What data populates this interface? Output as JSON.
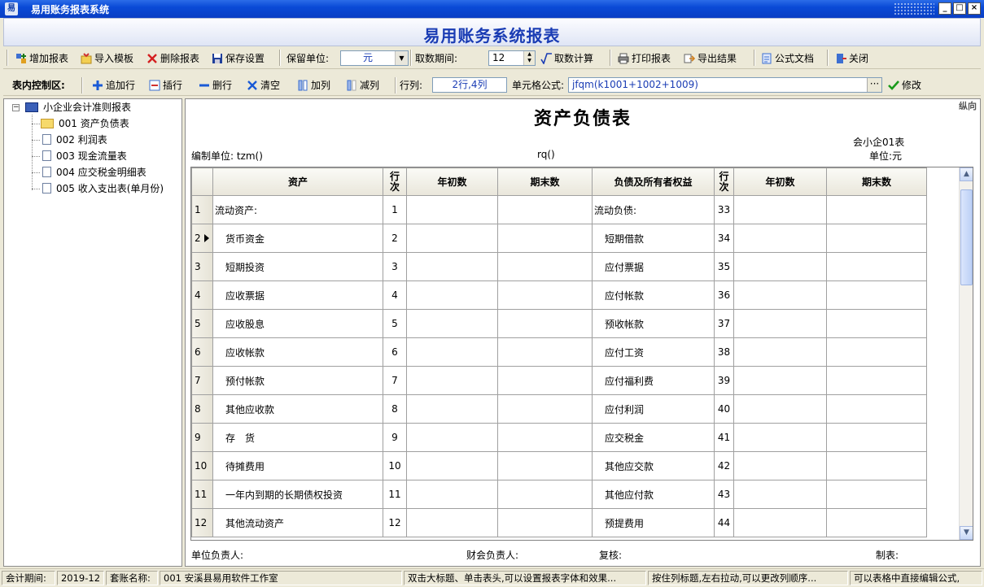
{
  "window": {
    "title": "易用账务报表系统",
    "icon_char": "易",
    "minimize": "_",
    "maximize": "□",
    "close": "×"
  },
  "banner": {
    "title": "易用账务系统报表"
  },
  "toolbar": {
    "add_report": "增加报表",
    "import_template": "导入模板",
    "delete_report": "删除报表",
    "save_settings": "保存设置",
    "unit_label": "保留单位:",
    "unit_value": "元",
    "period_label": "取数期间:",
    "period_value": "12",
    "calc": "取数计算",
    "print": "打印报表",
    "export": "导出结果",
    "formula_doc": "公式文档",
    "close": "关闭"
  },
  "control": {
    "label": "表内控制区:",
    "append_row": "追加行",
    "insert_row": "插行",
    "delete_row": "删行",
    "clear": "清空",
    "add_col": "加列",
    "remove_col": "减列",
    "rowcol_label": "行列:",
    "rowcol_value": "2行,4列",
    "formula_label": "单元格公式:",
    "formula_value": "jfqm(k1001+1002+1009)",
    "ellipsis": "···",
    "modify": "修改"
  },
  "tree": {
    "root": "小企业会计准则报表",
    "items": [
      {
        "code": "001",
        "name": "资产负债表"
      },
      {
        "code": "002",
        "name": "利润表"
      },
      {
        "code": "003",
        "name": "现金流量表"
      },
      {
        "code": "004",
        "name": "应交税金明细表"
      },
      {
        "code": "005",
        "name": "收入支出表(单月份)"
      }
    ]
  },
  "report": {
    "orientation": "纵向",
    "title": "资产负债表",
    "form_code": "会小企01表",
    "compiler": "编制单位: tzm()",
    "date": "rq()",
    "unit": "单位:元",
    "headers": {
      "assets": "资产",
      "line_no": "行次",
      "begin": "年初数",
      "end": "期末数",
      "liabilities": "负债及所有者权益",
      "line_no2": "行次",
      "begin2": "年初数",
      "end2": "期末数"
    },
    "rows": [
      {
        "n": "1",
        "asset": "流动资产:",
        "l1": "1",
        "liab": "流动负债:",
        "l2": "33"
      },
      {
        "n": "2",
        "asset": "货币资金",
        "l1": "2",
        "liab": "短期借款",
        "l2": "34"
      },
      {
        "n": "3",
        "asset": "短期投资",
        "l1": "3",
        "liab": "应付票据",
        "l2": "35"
      },
      {
        "n": "4",
        "asset": "应收票据",
        "l1": "4",
        "liab": "应付帐款",
        "l2": "36"
      },
      {
        "n": "5",
        "asset": "应收股息",
        "l1": "5",
        "liab": "预收帐款",
        "l2": "37"
      },
      {
        "n": "6",
        "asset": "应收帐款",
        "l1": "6",
        "liab": "应付工资",
        "l2": "38"
      },
      {
        "n": "7",
        "asset": "预付帐款",
        "l1": "7",
        "liab": "应付福利费",
        "l2": "39"
      },
      {
        "n": "8",
        "asset": "其他应收款",
        "l1": "8",
        "liab": "应付利润",
        "l2": "40"
      },
      {
        "n": "9",
        "asset": "存　货",
        "l1": "9",
        "liab": "应交税金",
        "l2": "41"
      },
      {
        "n": "10",
        "asset": "待摊费用",
        "l1": "10",
        "liab": "其他应交款",
        "l2": "42"
      },
      {
        "n": "11",
        "asset": "一年内到期的长期债权投资",
        "l1": "11",
        "liab": "其他应付款",
        "l2": "43"
      },
      {
        "n": "12",
        "asset": "其他流动资产",
        "l1": "12",
        "liab": "预提费用",
        "l2": "44"
      }
    ],
    "footer": {
      "owner": "单位负责人:",
      "finance": "财会负责人:",
      "review": "复核:",
      "maker": "制表:"
    }
  },
  "status": {
    "period_label": "会计期间:",
    "period_value": "2019-12",
    "set_label": "套账名称:",
    "set_value": "001 安溪县易用软件工作室",
    "hint1": "双击大标题、单击表头,可以设置报表字体和效果...",
    "hint2": "按住列标题,左右拉动,可以更改列顺序...",
    "hint3": "可以表格中直接编辑公式,"
  },
  "colors": {
    "titlebar": "#0a4ad6",
    "banner_text": "#1a3cb4",
    "accent_blue": "#1a3cb4"
  }
}
